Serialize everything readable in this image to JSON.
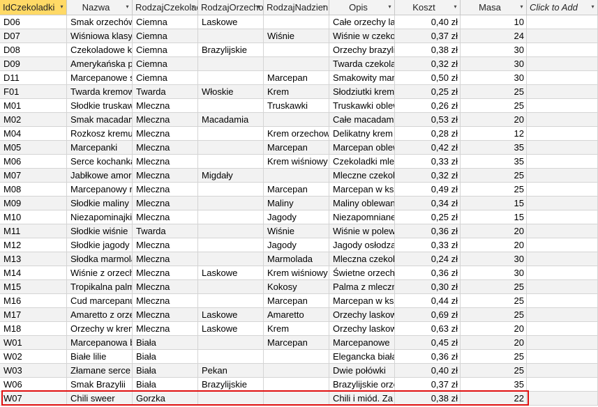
{
  "columns": [
    {
      "label": "IdCzekoladki",
      "name": "col-idczekoladki"
    },
    {
      "label": "Nazwa",
      "name": "col-nazwa"
    },
    {
      "label": "RodzajCzekolady",
      "name": "col-rodzajczekolady"
    },
    {
      "label": "RodzajOrzechow",
      "name": "col-rodzajorzechow"
    },
    {
      "label": "RodzajNadzienia",
      "name": "col-rodzajnadzienia"
    },
    {
      "label": "Opis",
      "name": "col-opis"
    },
    {
      "label": "Koszt",
      "name": "col-koszt"
    },
    {
      "label": "Masa",
      "name": "col-masa"
    },
    {
      "label": "Click to Add",
      "name": "col-click-to-add"
    }
  ],
  "rows": [
    [
      "D06",
      "Smak orzechów",
      "Ciemna",
      "Laskowe",
      "",
      "Całe orzechy laskowe",
      "0,40 zł",
      "10"
    ],
    [
      "D07",
      "Wiśniowa klasyka",
      "Ciemna",
      "",
      "Wiśnie",
      "Wiśnie w czekoladzie",
      "0,37 zł",
      "24"
    ],
    [
      "D08",
      "Czekoladowe kostki",
      "Ciemna",
      "Brazylijskie",
      "",
      "Orzechy brazylijskie",
      "0,38 zł",
      "30"
    ],
    [
      "D09",
      "Amerykańska pianka",
      "Ciemna",
      "",
      "",
      "Twarda czekolada",
      "0,32 zł",
      "30"
    ],
    [
      "D11",
      "Marcepanowe szczęście",
      "Ciemna",
      "",
      "Marcepan",
      "Smakowity marcepan",
      "0,50 zł",
      "30"
    ],
    [
      "F01",
      "Twarda kremowa",
      "Twarda",
      "Włoskie",
      "Krem",
      "Słodziutki krem",
      "0,25 zł",
      "25"
    ],
    [
      "M01",
      "Słodkie truskawki",
      "Mleczna",
      "",
      "Truskawki",
      "Truskawki oblewane",
      "0,26 zł",
      "25"
    ],
    [
      "M02",
      "Smak macadamii",
      "Mleczna",
      "Macadamia",
      "",
      "Całe macadamie",
      "0,53 zł",
      "20"
    ],
    [
      "M04",
      "Rozkosz kremu",
      "Mleczna",
      "",
      "Krem orzechowy",
      "Delikatny krem",
      "0,28 zł",
      "12"
    ],
    [
      "M05",
      "Marcepanki",
      "Mleczna",
      "",
      "Marcepan",
      "Marcepan oblewany",
      "0,42 zł",
      "35"
    ],
    [
      "M06",
      "Serce kochanka",
      "Mleczna",
      "",
      "Krem wiśniowy",
      "Czekoladki mleczne",
      "0,33 zł",
      "35"
    ],
    [
      "M07",
      "Jabłkowe amore",
      "Mleczna",
      "Migdały",
      "",
      "Mleczne czekoladki",
      "0,32 zł",
      "25"
    ],
    [
      "M08",
      "Marcepanowy raj",
      "Mleczna",
      "",
      "Marcepan",
      "Marcepan w kształcie",
      "0,49 zł",
      "25"
    ],
    [
      "M09",
      "Słodkie maliny",
      "Mleczna",
      "",
      "Maliny",
      "Maliny oblewane",
      "0,34 zł",
      "15"
    ],
    [
      "M10",
      "Niezapominajki",
      "Mleczna",
      "",
      "Jagody",
      "Niezapomniane",
      "0,25 zł",
      "15"
    ],
    [
      "M11",
      "Słodkie wiśnie",
      "Twarda",
      "",
      "Wiśnie",
      "Wiśnie w polewie",
      "0,36 zł",
      "20"
    ],
    [
      "M12",
      "Słodkie jagody",
      "Mleczna",
      "",
      "Jagody",
      "Jagody osłodzane",
      "0,33 zł",
      "20"
    ],
    [
      "M13",
      "Słodka marmolada",
      "Mleczna",
      "",
      "Marmolada",
      "Mleczna czekolada",
      "0,24 zł",
      "30"
    ],
    [
      "M14",
      "Wiśnie z orzechami",
      "Mleczna",
      "Laskowe",
      "Krem wiśniowy",
      "Świetne orzechy",
      "0,36 zł",
      "30"
    ],
    [
      "M15",
      "Tropikalna palma",
      "Mleczna",
      "",
      "Kokosy",
      "Palma z mlecznej",
      "0,30 zł",
      "25"
    ],
    [
      "M16",
      "Cud marcepanu",
      "Mleczna",
      "",
      "Marcepan",
      "Marcepan w ksz.",
      "0,44 zł",
      "25"
    ],
    [
      "M17",
      "Amaretto z orzechami",
      "Mleczna",
      "Laskowe",
      "Amaretto",
      "Orzechy laskowe",
      "0,69 zł",
      "25"
    ],
    [
      "M18",
      "Orzechy w kremie",
      "Mleczna",
      "Laskowe",
      "Krem",
      "Orzechy laskowe",
      "0,63 zł",
      "20"
    ],
    [
      "W01",
      "Marcepanowa biel",
      "Biała",
      "",
      "Marcepan",
      "Marcepanowe",
      "0,45 zł",
      "20"
    ],
    [
      "W02",
      "Białe lilie",
      "Biała",
      "",
      "",
      "Elegancka biała",
      "0,36 zł",
      "25"
    ],
    [
      "W03",
      "Złamane serce",
      "Biała",
      "Pekan",
      "",
      "Dwie połówki",
      "0,40 zł",
      "25"
    ],
    [
      "W06",
      "Smak Brazylii",
      "Biała",
      "Brazylijskie",
      "",
      "Brazylijskie orzechy",
      "0,37 zł",
      "35"
    ],
    [
      "W07",
      "Chili sweer",
      "Gorzka",
      "",
      "",
      "Chili i miód. Za",
      "0,38 zł",
      "22"
    ]
  ]
}
